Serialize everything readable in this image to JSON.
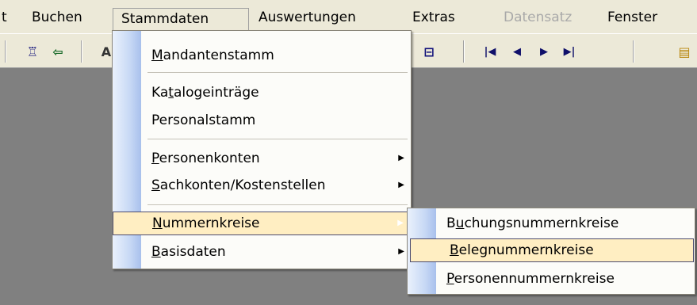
{
  "menubar": {
    "items": [
      {
        "label": "t"
      },
      {
        "label": "Buchen"
      },
      {
        "label": "Stammdaten"
      },
      {
        "label": "Auswertungen"
      },
      {
        "label": "Extras"
      },
      {
        "label": "Datensatz",
        "disabled": true
      },
      {
        "label": "Fenster"
      }
    ]
  },
  "stammdaten_menu": {
    "items": [
      {
        "label": "Mandantenstamm",
        "accel": "M",
        "rest": "andantenstamm"
      },
      {
        "label": "Katalogeinträge",
        "pre": "Ka",
        "accel": "t",
        "rest": "alogeinträge"
      },
      {
        "label": "Personalstamm"
      },
      {
        "label": "Personenkonten",
        "accel": "P",
        "rest": "ersonenkonten",
        "submenu": true
      },
      {
        "label": "Sachkonten/Kostenstellen",
        "accel": "S",
        "rest": "achkonten/Kostenstellen",
        "submenu": true
      },
      {
        "label": "Nummernkreise",
        "accel": "N",
        "rest": "ummernkreise",
        "submenu": true,
        "highlighted": true
      },
      {
        "label": "Basisdaten",
        "accel": "B",
        "rest": "asisdaten",
        "submenu": true
      }
    ]
  },
  "nummernkreise_submenu": {
    "items": [
      {
        "label": "Buchungsnummernkreise",
        "pre": "B",
        "accel": "u",
        "rest": "chungsnummernkreise"
      },
      {
        "label": "Belegnummernkreise",
        "accel": "B",
        "rest": "elegnummernkreise",
        "highlighted": true
      },
      {
        "label": "Personennummernkreise",
        "accel": "P",
        "rest": "ersonennummernkreise"
      }
    ]
  },
  "toolbar": {
    "icons": [
      "employee-icon",
      "import-icon",
      "text-icon",
      "grid-icon",
      "first-record-icon",
      "previous-record-icon",
      "next-record-icon",
      "last-record-icon",
      "clipboard-icon"
    ],
    "glyphs": {
      "employee": "♖",
      "import": "⇦",
      "text": "A",
      "grid": "⊟",
      "first": "|◀",
      "prev": "◀",
      "next": "▶",
      "last": "▶|",
      "clipboard": "▤"
    }
  },
  "colors": {
    "menu_highlight": "#ffeec2",
    "desktop": "#808080",
    "chrome": "#ece9d8"
  }
}
